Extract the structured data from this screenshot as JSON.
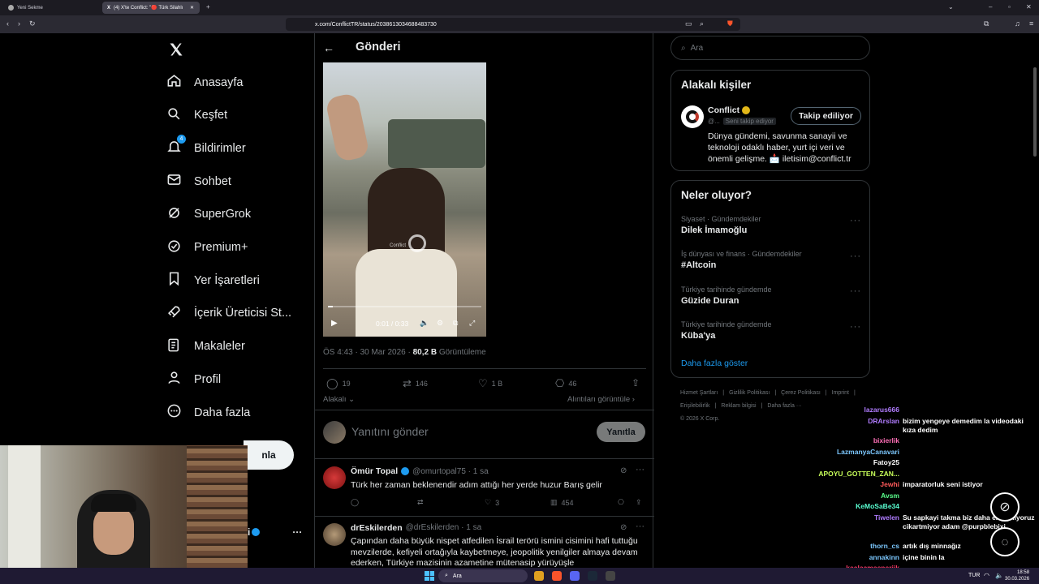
{
  "browser": {
    "tabs": [
      {
        "label": "Yeni Sekme"
      },
      {
        "label": "(4) X'te Conflict: \"🔴 Türk Silahlı"
      }
    ],
    "url": "x.com/ConflictTR/status/2038613034688483730"
  },
  "sidebar": {
    "items": [
      {
        "label": "Anasayfa",
        "icon": "home-icon"
      },
      {
        "label": "Keşfet",
        "icon": "search-icon"
      },
      {
        "label": "Bildirimler",
        "icon": "bell-icon",
        "badge": "4"
      },
      {
        "label": "Sohbet",
        "icon": "mail-icon"
      },
      {
        "label": "SuperGrok",
        "icon": "grok-icon"
      },
      {
        "label": "Premium+",
        "icon": "verified-icon"
      },
      {
        "label": "Yer İşaretleri",
        "icon": "bookmark-icon"
      },
      {
        "label": "İçerik Üreticisi St...",
        "icon": "rocket-icon"
      },
      {
        "label": "Makaleler",
        "icon": "article-icon"
      },
      {
        "label": "Profil",
        "icon": "person-icon"
      },
      {
        "label": "Daha fazla",
        "icon": "more-circle-icon"
      }
    ],
    "post_button": "nla",
    "account_fragment": "i"
  },
  "header": {
    "title": "Gönderi"
  },
  "video": {
    "time": "0:01 / 0:33",
    "watermark": "Conflict",
    "progress": 0.03
  },
  "post": {
    "time": "ÖS 4:43 · 30 Mar 2026 ·",
    "views_count": "80,2 B",
    "views_label": "Görüntüleme",
    "replies": "19",
    "reposts": "146",
    "likes": "1 B",
    "bookmarks": "46",
    "relevant": "Alakalı",
    "quotes": "Alıntıları görüntüle"
  },
  "reply_box": {
    "placeholder": "Yanıtını gönder",
    "button": "Yanıtla"
  },
  "replies": [
    {
      "name": "Ömür Topal",
      "handle": "@omurtopal75 · 1 sa",
      "text": "Türk her zaman beklenendir adım attığı her yerde huzur Barış gelir",
      "likes": "3",
      "views": "454"
    },
    {
      "name": "drEskilerden",
      "handle": "@drEskilerden · 1 sa",
      "text": "Çapından daha büyük nispet atfedilen İsrail terörü ismini cisimini hafi tuttuğu mevzilerde, kefiyeli ortağıyla kaybetmeye, jeopolitik yenilgiler almaya devam ederken, Türkiye mazisinin azametine mütenasip yürüyüşle"
    }
  ],
  "search": {
    "placeholder": "Ara"
  },
  "related": {
    "title": "Alakalı kişiler",
    "name": "Conflict",
    "handle": "@...",
    "follows_you": "Seni takip ediyor",
    "follow_button": "Takip ediliyor",
    "bio": "Dünya gündemi, savunma sanayii ve teknoloji odaklı haber, yurt içi veri ve önemli gelişme. 📩 iletisim@conflict.tr"
  },
  "trends": {
    "title": "Neler oluyor?",
    "items": [
      {
        "category": "Siyaset · Gündemdekiler",
        "name": "Dilek İmamoğlu"
      },
      {
        "category": "İş dünyası ve finans · Gündemdekiler",
        "name": "#Altcoin"
      },
      {
        "category": "Türkiye tarihinde gündemde",
        "name": "Güzide Duran"
      },
      {
        "category": "Türkiye tarihinde gündemde",
        "name": "Küba'ya"
      }
    ],
    "more": "Daha fazla göster"
  },
  "footer": {
    "links": [
      "Hizmet Şartları",
      "|",
      "Gizlilik Politikası",
      "|",
      "Çerez Politikası",
      "|",
      "Imprint",
      "|",
      "Erişilebilirlik",
      "|",
      "Reklam bilgisi",
      "|",
      "Daha fazla ···"
    ],
    "copyright": "© 2026 X Corp."
  },
  "chat": [
    {
      "user": "lazarus666",
      "msg": "",
      "color": "#b07cff"
    },
    {
      "user": "DRArslan",
      "msg": "bizim yengeye demedim la videodaki kıza dedim",
      "color": "#b07cff"
    },
    {
      "user": "bixierlik",
      "msg": "",
      "color": "#ff6fb7"
    },
    {
      "user": "LazmanyaCanavari",
      "msg": "",
      "color": "#7cc8ff"
    },
    {
      "user": "Fatoy25",
      "msg": "",
      "color": "#ffffff"
    },
    {
      "user": "APOYU_GOTTEN_ZAN...",
      "msg": "",
      "color": "#c8ff5a"
    },
    {
      "user": "Jewhi",
      "msg": "imparatorluk seni istiyor",
      "color": "#ff5a5a"
    },
    {
      "user": "Avsm",
      "msg": "",
      "color": "#5aff8c"
    },
    {
      "user": "KeMoSaBe34",
      "msg": "",
      "color": "#5affd2"
    },
    {
      "user": "Tiwelen",
      "msg": "Su sapkayi takma biz daha erisemiyoruz cikartmiyor adam @purpblebixi",
      "color": "#b07cff"
    },
    {
      "user": "thorn_cs",
      "msg": "artık dış minnağız",
      "color": "#7cc8ff"
    },
    {
      "user": "annakinn",
      "msg": "içine binin la",
      "color": "#7cc8ff"
    },
    {
      "user": "kealaamaenerjik",
      "msg": "",
      "color": "#ff3b6b"
    }
  ],
  "taskbar": {
    "search": "Ara",
    "lang": "TUR",
    "time": "18:58",
    "date": "30.03.2026"
  },
  "colors": {
    "accent": "#1d9bf0",
    "verified": "#1d9bf0",
    "gold": "#e2b719",
    "bg": "#000000",
    "border": "#2f3336"
  }
}
